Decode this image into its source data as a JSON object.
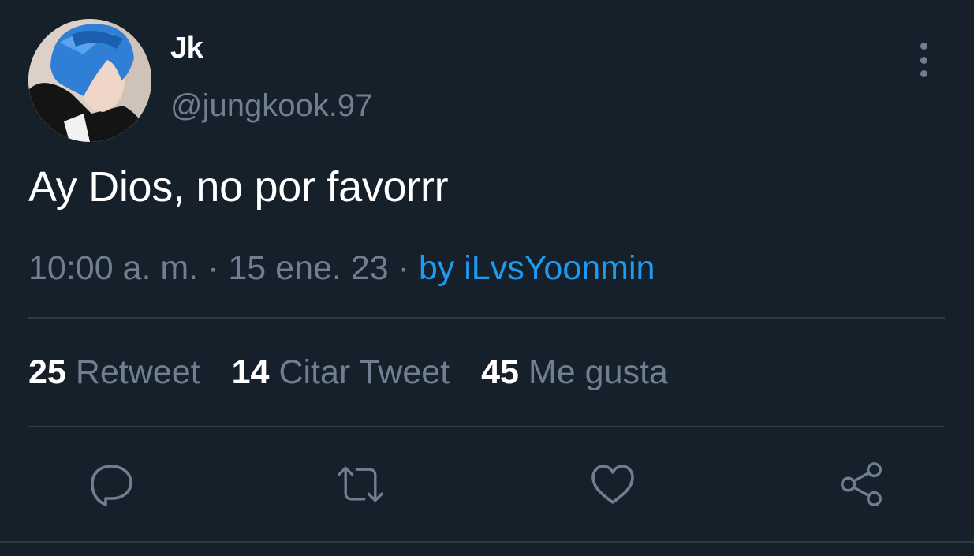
{
  "author": {
    "display_name": "Jk",
    "handle": "@jungkook.97"
  },
  "tweet": {
    "text": "Ay Dios, no por favorrr",
    "time": "10:00 a. m.",
    "separator": "·",
    "date": "15 ene. 23",
    "source": "by iLvsYoonmin"
  },
  "stats": {
    "retweets": {
      "count": "25",
      "label": "Retweet"
    },
    "quotes": {
      "count": "14",
      "label": "Citar Tweet"
    },
    "likes": {
      "count": "45",
      "label": "Me gusta"
    }
  },
  "actions": {
    "reply_icon": "reply-icon",
    "retweet_icon": "retweet-icon",
    "like_icon": "heart-icon",
    "share_icon": "share-icon"
  },
  "colors": {
    "background": "#16202b",
    "secondary_text": "#6e7f91",
    "link": "#1d9bf0"
  }
}
